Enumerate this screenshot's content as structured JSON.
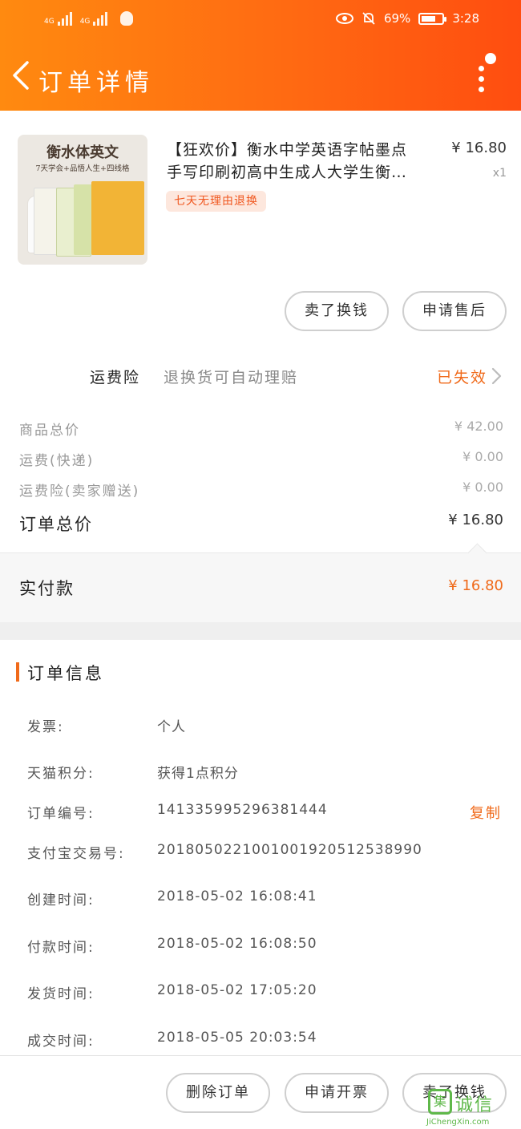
{
  "status_bar": {
    "signal1_label": "4G",
    "signal2_label": "4G",
    "battery_text": "69%",
    "battery_level": 0.69,
    "time": "3:28"
  },
  "nav": {
    "title": "订单详情"
  },
  "product": {
    "image_title": "衡水体英文",
    "image_subtitle": "7天学会+品悟人生+四线格",
    "title_line1": "【狂欢价】衡水中学英语字帖墨点",
    "title_line2": "手写印刷初高中生成人大学生衡…",
    "price": "¥ 16.80",
    "quantity": "x1",
    "tag": "七天无理由退换"
  },
  "product_actions": {
    "sell_label": "卖了换钱",
    "aftersale_label": "申请售后"
  },
  "insurance": {
    "label": "运费险",
    "description": "退换货可自动理赔",
    "status": "已失效"
  },
  "price_summary": {
    "rows": [
      {
        "label": "商品总价",
        "value": "¥ 42.00"
      },
      {
        "label": "运费(快递)",
        "value": "¥ 0.00"
      },
      {
        "label": "运费险(卖家赠送)",
        "value": "¥ 0.00"
      }
    ],
    "total_label": "订单总价",
    "total_value": "¥ 16.80"
  },
  "paid": {
    "label": "实付款",
    "value": "¥ 16.80"
  },
  "order_info": {
    "title": "订单信息",
    "rows": [
      {
        "label": "发票:",
        "value": "个人"
      },
      {
        "label": "天猫积分:",
        "value": "获得1点积分"
      },
      {
        "label": "订单编号:",
        "value": "141335995296381444"
      },
      {
        "label": "支付宝交易号:",
        "value": "2018050221001001920512538990"
      },
      {
        "label": "创建时间:",
        "value": "2018-05-02 16:08:41"
      },
      {
        "label": "付款时间:",
        "value": "2018-05-02 16:08:50"
      },
      {
        "label": "发货时间:",
        "value": "2018-05-02 17:05:20"
      },
      {
        "label": "成交时间:",
        "value": "2018-05-05 20:03:54"
      }
    ],
    "copy_label": "复制"
  },
  "bottom_actions": {
    "delete_label": "删除订单",
    "invoice_label": "申请开票",
    "sell_label": "卖了换钱"
  },
  "watermark": {
    "logo_char": "集",
    "text": "诚信",
    "url": "JiChengXin.com"
  },
  "colors": {
    "header_gradient_start": "#ff8a10",
    "header_gradient_end": "#ff4d10",
    "accent": "#f06a1a"
  }
}
